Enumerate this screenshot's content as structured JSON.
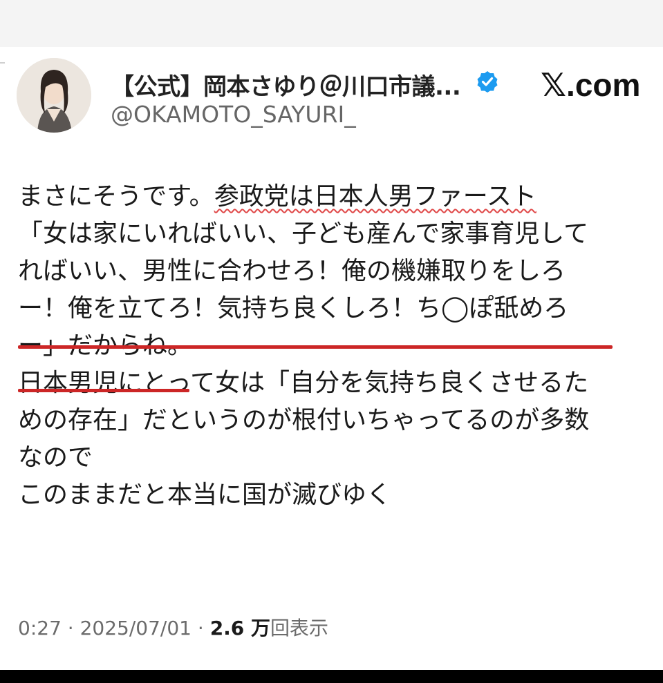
{
  "author": {
    "name": "【公式】岡本さゆり＠川口市議...",
    "handle": "@OKAMOTO_SAYURI_",
    "verified": true,
    "verified_color": "#1d9bf0"
  },
  "site_logo": "𝕏.com",
  "post": {
    "line1_prefix": "まさにそうです。",
    "line1_highlight": "参政党は日本人男ファースト",
    "line2": "「女は家にいればいい、子ども産んで家事育児して",
    "line3": "ればいい、男性に合わせろ！俺の機嫌取りをしろ",
    "line4": "ー！俺を立てろ！気持ち良くしろ！ち◯ぽ舐めろ",
    "line5": "ー」だからね。",
    "line6": "日本男児にとって女は「自分を気持ち良くさせるた",
    "line7": "めの存在」だというのが根付いちゃってるのが多数",
    "line8": "なので",
    "line9": "このままだと本当に国が滅びゆく"
  },
  "meta": {
    "time": "0:27",
    "sep1": " · ",
    "date": "2025/07/01",
    "sep2": " · ",
    "views_count": "2.6 万",
    "views_label": "回表示"
  },
  "colors": {
    "underline_red": "#cc2626",
    "wavy_red": "#e04848"
  }
}
